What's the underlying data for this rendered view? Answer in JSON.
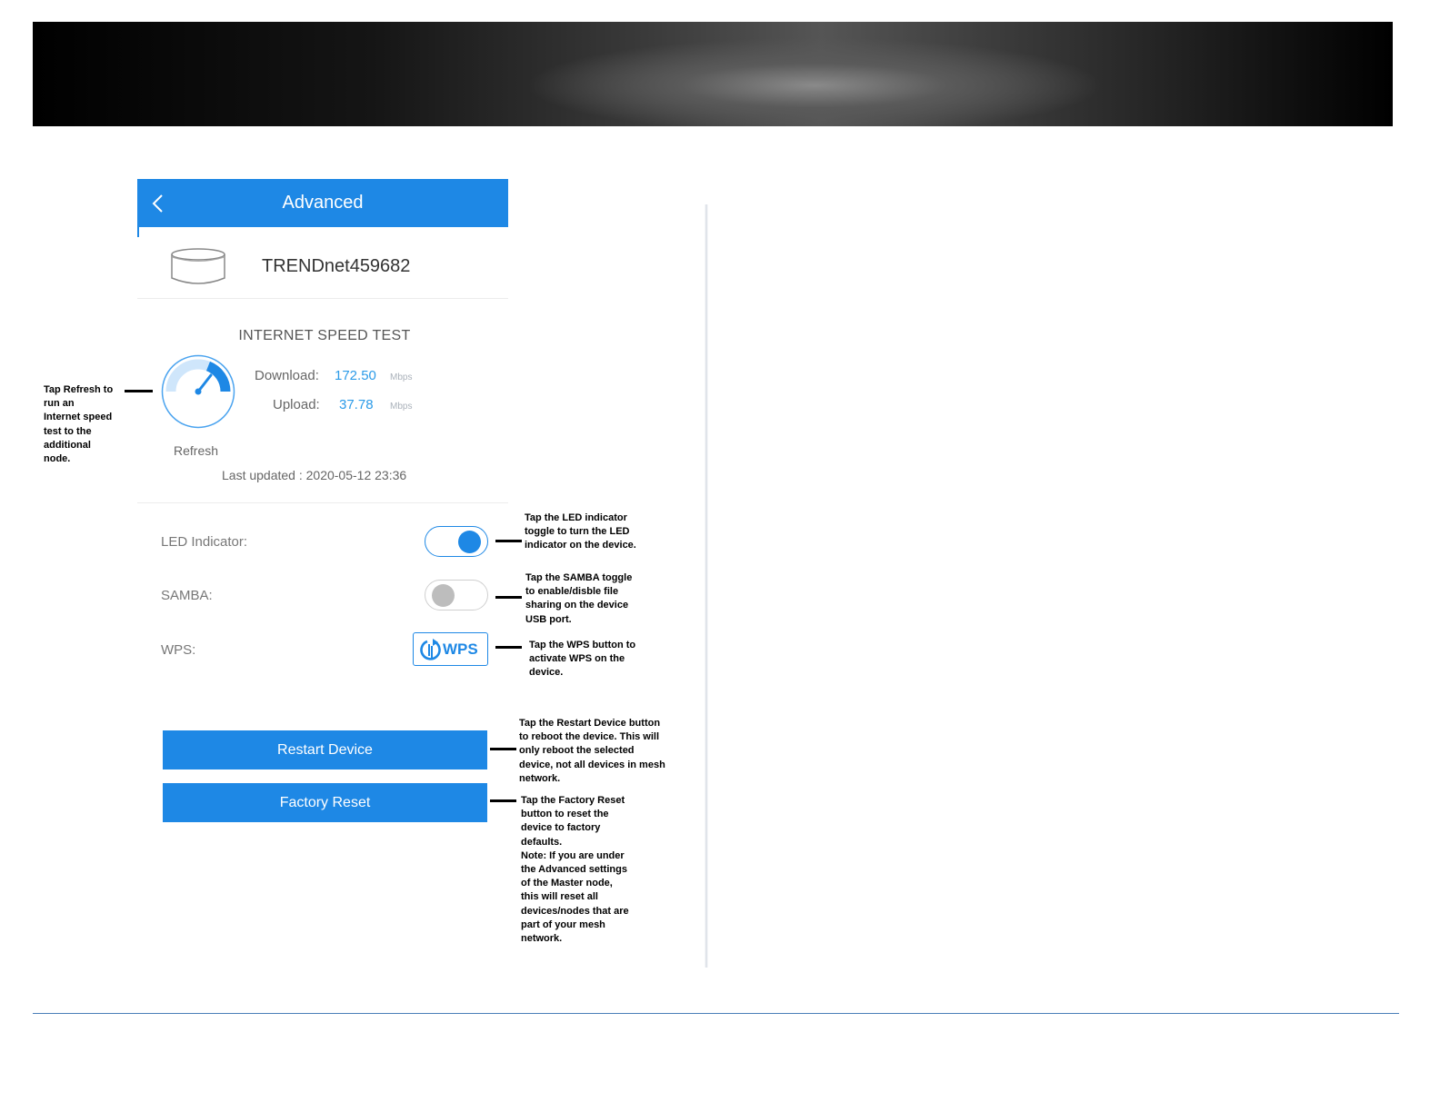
{
  "screen": {
    "header_title": "Advanced",
    "device_name": "TRENDnet459682",
    "speed_test": {
      "title": "INTERNET SPEED TEST",
      "download_label": "Download:",
      "download_value": "172.50",
      "download_unit": "Mbps",
      "upload_label": "Upload:",
      "upload_value": "37.78",
      "upload_unit": "Mbps",
      "refresh_label": "Refresh",
      "last_updated": "Last updated : 2020-05-12 23:36"
    },
    "settings": {
      "led_label": "LED Indicator:",
      "led_on": true,
      "samba_label": "SAMBA:",
      "samba_on": false,
      "wps_label": "WPS:",
      "wps_button": "WPS"
    },
    "buttons": {
      "restart": "Restart Device",
      "factory_reset": "Factory Reset"
    }
  },
  "callouts": {
    "refresh": "Tap Refresh to\nrun an\nInternet speed\ntest to the\nadditional\nnode.",
    "led": "Tap the LED indicator\ntoggle to turn the LED\nindicator on the device.",
    "samba": "Tap the SAMBA toggle\nto enable/disble file\nsharing on the device\nUSB port.",
    "wps": "Tap the WPS button to\nactivate WPS on the\ndevice.",
    "restart": "Tap the Restart Device button\nto reboot the device. This will\nonly reboot the selected\ndevice, not all devices in mesh\nnetwork.",
    "factory": "Tap the Factory Reset\nbutton to reset the\ndevice to factory\ndefaults.\nNote: If you are under\nthe Advanced settings\nof the Master node,\nthis will reset all\ndevices/nodes that are\npart of your mesh\nnetwork."
  },
  "colors": {
    "accent": "#1e88e5",
    "value_blue": "#2c9be8",
    "toggle_off": "#bdbdbd"
  },
  "icons": [
    "back-chevron-icon",
    "router-device-icon",
    "speedometer-icon",
    "wps-icon"
  ]
}
